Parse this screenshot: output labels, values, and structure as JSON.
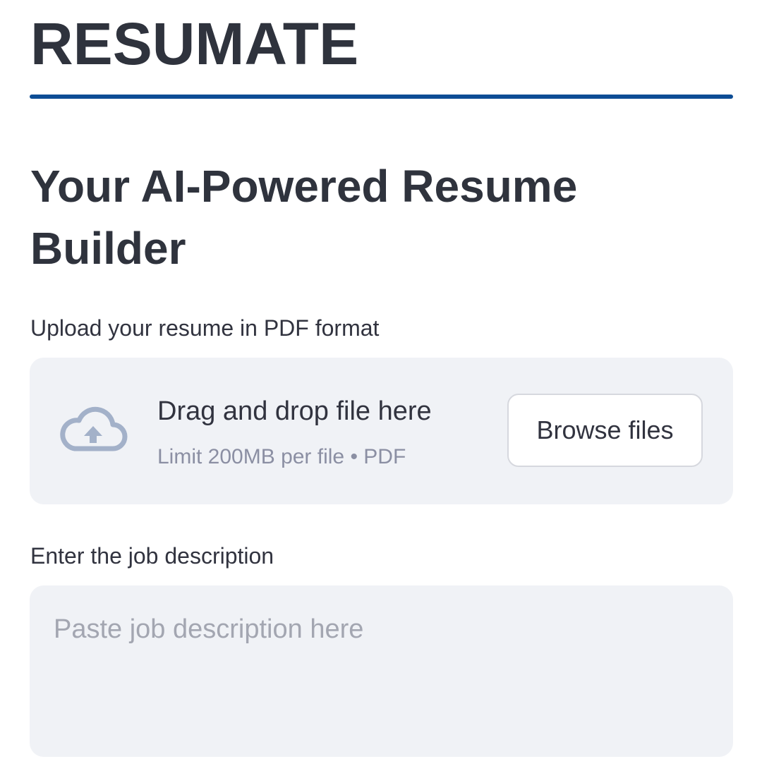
{
  "app": {
    "title": "RESUMATE",
    "subtitle": "Your AI-Powered Resume Builder",
    "accent_color": "#0d4d95"
  },
  "upload": {
    "label": "Upload your resume in PDF format",
    "drop_text": "Drag and drop file here",
    "limit_text": "Limit 200MB per file • PDF",
    "browse_label": "Browse files",
    "icon": "cloud-upload-icon"
  },
  "job_description": {
    "label": "Enter the job description",
    "placeholder": "Paste job description here",
    "value": ""
  }
}
